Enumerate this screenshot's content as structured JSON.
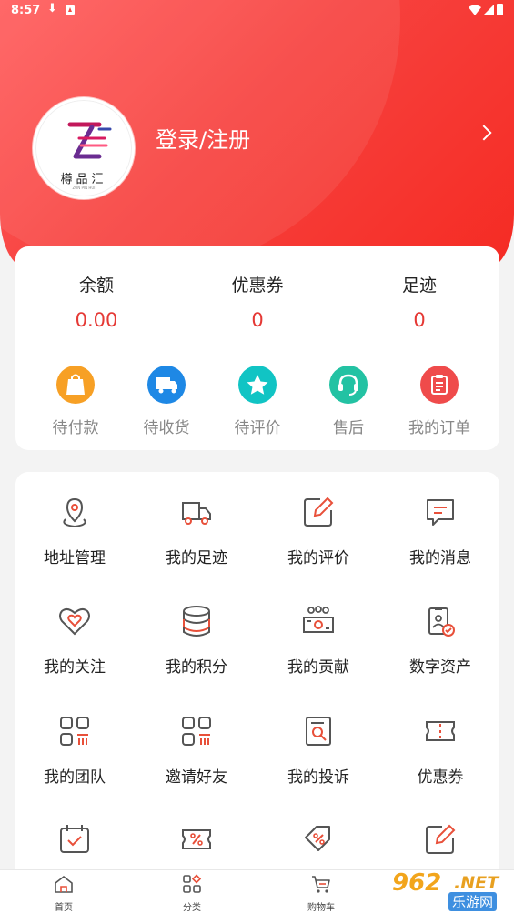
{
  "status_bar": {
    "time": "8:57"
  },
  "profile": {
    "login_label": "登录/注册",
    "logo_text": "樽品汇",
    "logo_sub": "ZUN PIN HUI"
  },
  "stats": [
    {
      "label": "余额",
      "value": "0.00"
    },
    {
      "label": "优惠券",
      "value": "0"
    },
    {
      "label": "足迹",
      "value": "0"
    }
  ],
  "orders": [
    {
      "label": "待付款",
      "icon": "shopping-bag-icon",
      "color": "#f7a025"
    },
    {
      "label": "待收货",
      "icon": "truck-icon",
      "color": "#1e88e5"
    },
    {
      "label": "待评价",
      "icon": "star-icon",
      "color": "#11c4c4"
    },
    {
      "label": "售后",
      "icon": "headset-icon",
      "color": "#23c2a3"
    },
    {
      "label": "我的订单",
      "icon": "clipboard-icon",
      "color": "#ef4b4b"
    }
  ],
  "services": [
    {
      "label": "地址管理",
      "icon": "location-pin-icon"
    },
    {
      "label": "我的足迹",
      "icon": "truck-outline-icon"
    },
    {
      "label": "我的评价",
      "icon": "edit-square-icon"
    },
    {
      "label": "我的消息",
      "icon": "message-icon"
    },
    {
      "label": "我的关注",
      "icon": "heart-icon"
    },
    {
      "label": "我的积分",
      "icon": "coin-stack-icon"
    },
    {
      "label": "我的贡献",
      "icon": "team-money-icon"
    },
    {
      "label": "数字资产",
      "icon": "badge-check-icon"
    },
    {
      "label": "我的团队",
      "icon": "grid-apps-icon"
    },
    {
      "label": "邀请好友",
      "icon": "grid-apps-icon"
    },
    {
      "label": "我的投诉",
      "icon": "doc-search-icon"
    },
    {
      "label": "优惠券",
      "icon": "ticket-icon"
    },
    {
      "label": "",
      "icon": "calendar-check-icon"
    },
    {
      "label": "",
      "icon": "percent-ticket-icon"
    },
    {
      "label": "",
      "icon": "discount-tag-icon"
    },
    {
      "label": "",
      "icon": "edit-square-icon"
    }
  ],
  "nav": [
    {
      "label": "首页",
      "icon": "home-icon"
    },
    {
      "label": "分类",
      "icon": "category-icon"
    },
    {
      "label": "购物车",
      "icon": "cart-icon"
    }
  ],
  "watermark": {
    "number": "962",
    "tld": ".NET",
    "site": "乐游网"
  },
  "colors": {
    "accent": "#f5473f",
    "icon_dark": "#555555",
    "icon_red": "#e8503a"
  }
}
